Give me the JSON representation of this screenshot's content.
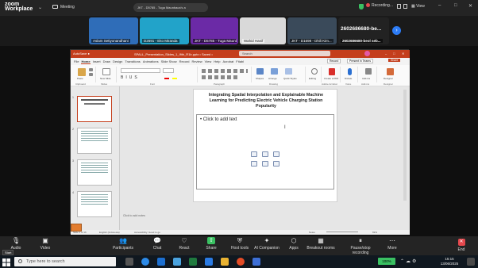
{
  "zoom": {
    "brand_line1": "zoom",
    "brand_line2": "Workplace",
    "meeting_label": "Meeting",
    "share_label": "JKT - D5785 - Tuga Maunbaca's a",
    "recording_label": "Recording...",
    "view_label": "View"
  },
  "participants": [
    {
      "name": "Aslam Setiyonandhani",
      "color": "#2f6db8"
    },
    {
      "name": "D2691 - Eko Miranda",
      "color": "#22a3c9"
    },
    {
      "name": "JKT - D5785 - Tuga Maunb...",
      "color": "#6b2aa6"
    },
    {
      "name": "Wahid Hanif",
      "color": "#d9d9d9"
    },
    {
      "name": "JKT - D1698 - Dhili Kim...",
      "color": "#3a4a5a"
    },
    {
      "name": "2602686680-be...",
      "sub": "2602686680-beol seb...",
      "color": "#222"
    }
  ],
  "ppt": {
    "title_bar": "SPALL_Presentation_Slides_1_Ifith_R1b.pptx • Saved •",
    "search_placeholder": "Search",
    "menu": [
      "File",
      "Home",
      "Insert",
      "Draw",
      "Design",
      "Transitions",
      "Animations",
      "Slide Show",
      "Record",
      "Review",
      "View",
      "Help",
      "Acrobat",
      "Fitabl"
    ],
    "record_btn": "Record",
    "present_teams": "Present in Teams",
    "share_btn": "Share",
    "ribbon_groups": [
      "Clipboard",
      "Slides",
      "Font",
      "Paragraph",
      "Drawing",
      "Adobe Acrobat",
      "Voice",
      "Add-ins",
      "Designer"
    ],
    "ribbon_buttons": {
      "paste": "Paste",
      "new_slide": "New Slide",
      "shapes": "Shapes",
      "arrange": "Arrange",
      "quick_styles": "Quick Styles",
      "editing": "Editing",
      "create_pdf": "Create a PDF",
      "dictate": "Dictate",
      "add_ins": "Add-ins",
      "designer": "Designer"
    },
    "slide_numbers": [
      "1",
      "2",
      "3",
      "4"
    ],
    "slide_title": "Integrating Spatial Interpolation and Explainable Machine Learning for Predicting Electric Vehicle Charging Station Popularity",
    "content_placeholder": "Click to add text",
    "notes_placeholder": "Click to add notes",
    "status_slide": "Slide 1 of 16",
    "status_lang": "English (Indonesia)",
    "status_accessibility": "Accessibility: Good to go",
    "status_notes": "Notes",
    "zoom_pct": "69%",
    "time": "15:15",
    "date": "13/06/2025"
  },
  "bottom_bar": [
    {
      "label": "Audio",
      "glyph": "🎙"
    },
    {
      "label": "Video",
      "glyph": "▣"
    },
    {
      "label": "Participants",
      "glyph": "👥"
    },
    {
      "label": "Chat",
      "glyph": "💬"
    },
    {
      "label": "React",
      "glyph": "♡"
    },
    {
      "label": "Share",
      "glyph": "⇧"
    },
    {
      "label": "Host tools",
      "glyph": "⛨"
    },
    {
      "label": "AI Companion",
      "glyph": "✦"
    },
    {
      "label": "Apps",
      "glyph": "⬡"
    },
    {
      "label": "Breakout rooms",
      "glyph": "▦"
    },
    {
      "label": "Pause/stop recording",
      "glyph": "⏸"
    },
    {
      "label": "More",
      "glyph": "⋯"
    }
  ],
  "end_label": "End",
  "taskbar": {
    "start_tooltip": "Start",
    "search_placeholder": "Type here to search",
    "battery": "100%",
    "clock_time": "15:15",
    "clock_date": "13/06/2025"
  },
  "colors": {
    "zoom_bg": "#242424",
    "ppt_accent": "#c43e1c",
    "share_green": "#3ac162",
    "end_red": "#e5484d",
    "next_blue": "#2d7cf6"
  }
}
